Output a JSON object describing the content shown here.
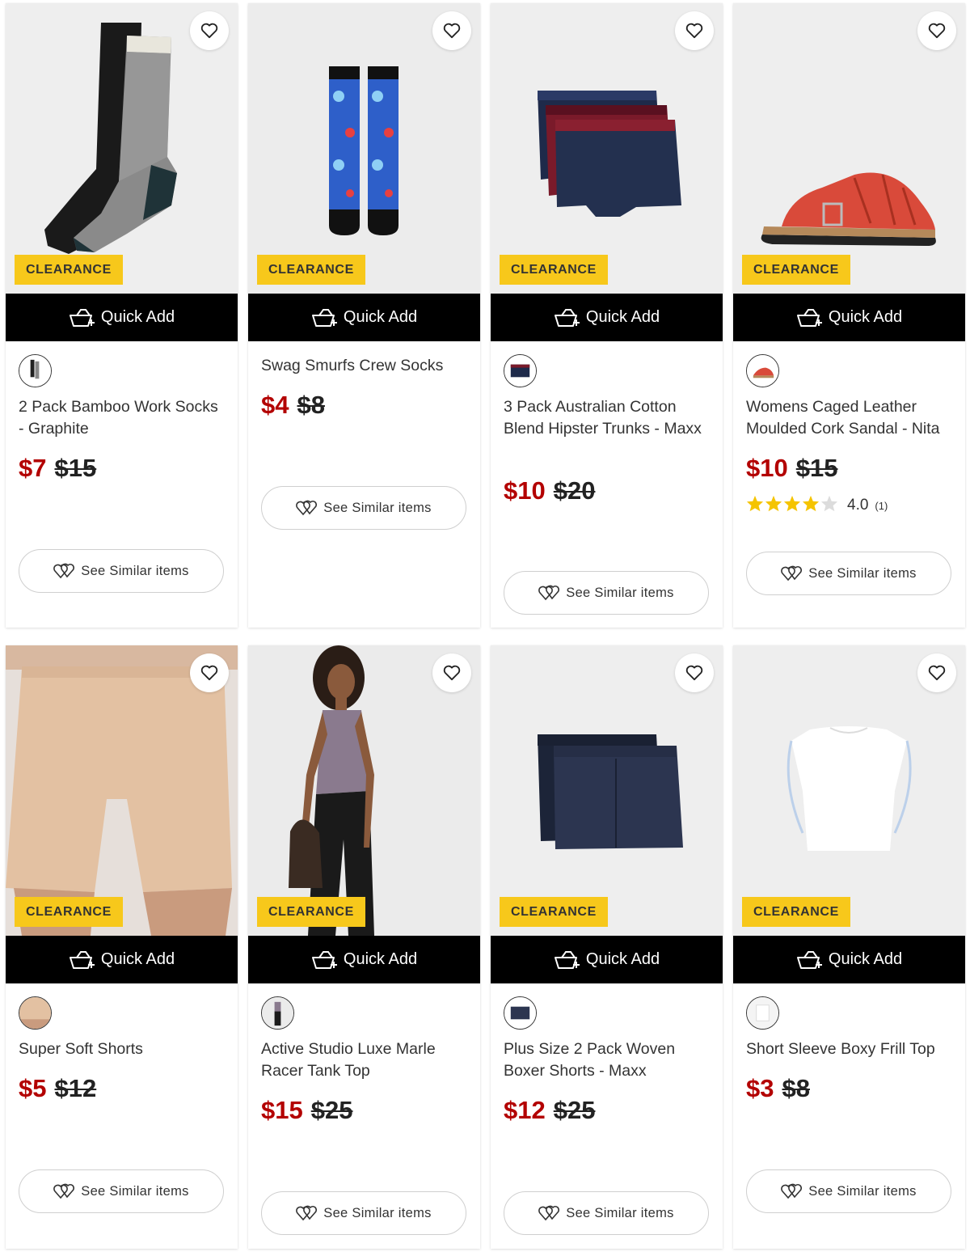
{
  "labels": {
    "badge": "CLEARANCE",
    "quick_add": "Quick Add",
    "see_similar": "See Similar items"
  },
  "colors": {
    "accent_badge": "#f7c81b",
    "sale_price": "#b30000",
    "quick_add_bg": "#000000",
    "star": "#f5c400"
  },
  "icons": {
    "wishlist": "heart-outline-icon",
    "cart": "basket-plus-icon",
    "similar": "hearts-icon"
  },
  "products": [
    {
      "name": "2 Pack Bamboo Work Socks - Graphite",
      "price": "$7",
      "was_price": "$15",
      "has_swatch": true,
      "clearance": true
    },
    {
      "name": "Swag Smurfs Crew Socks",
      "price": "$4",
      "was_price": "$8",
      "has_swatch": false,
      "clearance": true
    },
    {
      "name": "3 Pack Australian Cotton Blend Hipster Trunks - Maxx",
      "price": "$10",
      "was_price": "$20",
      "has_swatch": true,
      "clearance": true
    },
    {
      "name": "Womens Caged Leather Moulded Cork Sandal - Nita",
      "price": "$10",
      "was_price": "$15",
      "has_swatch": true,
      "clearance": true,
      "rating": {
        "value": "4.0",
        "count": "(1)",
        "stars": 4
      }
    },
    {
      "name": "Super Soft Shorts",
      "price": "$5",
      "was_price": "$12",
      "has_swatch": true,
      "clearance": true
    },
    {
      "name": "Active Studio Luxe Marle Racer Tank Top",
      "price": "$15",
      "was_price": "$25",
      "has_swatch": true,
      "clearance": true
    },
    {
      "name": "Plus Size 2 Pack Woven Boxer Shorts - Maxx",
      "price": "$12",
      "was_price": "$25",
      "has_swatch": true,
      "clearance": true
    },
    {
      "name": "Short Sleeve Boxy Frill Top",
      "price": "$3",
      "was_price": "$8",
      "has_swatch": true,
      "clearance": true
    }
  ]
}
